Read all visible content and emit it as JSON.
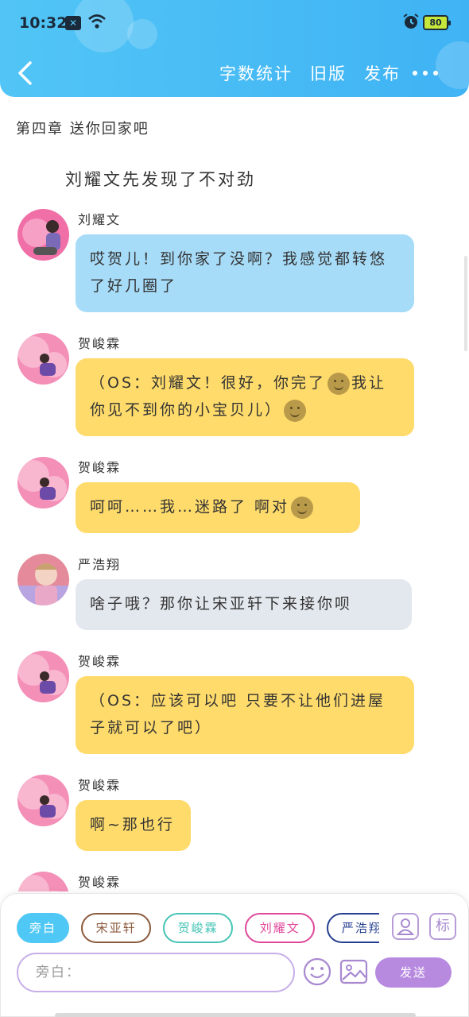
{
  "status_bar": {
    "time": "10:32",
    "battery": "80"
  },
  "header": {
    "actions": [
      "字数统计",
      "旧版",
      "发布"
    ]
  },
  "chapter": {
    "title": "第四章 送你回家吧",
    "narration": "刘耀文先发现了不对劲"
  },
  "messages": [
    {
      "speaker": "刘耀文",
      "style": "blue",
      "text": "哎贺儿！到你家了没啊？我感觉都转悠了好几圈了",
      "avatar_color": "#ef6fa6"
    },
    {
      "speaker": "贺峻霖",
      "style": "yellow",
      "parts": [
        "（OS：刘耀文！很好，你完了",
        "我让你见不到你的小宝贝儿）"
      ],
      "avatar_color": "#f48fb7"
    },
    {
      "speaker": "贺峻霖",
      "style": "yellow",
      "parts": [
        "呵呵……我…迷路了 啊对"
      ],
      "avatar_color": "#f48fb7"
    },
    {
      "speaker": "严浩翔",
      "style": "gray",
      "text": "啥子哦？那你让宋亚轩下来接你呗",
      "avatar_color": "#e48a9a"
    },
    {
      "speaker": "贺峻霖",
      "style": "yellow",
      "text": "（OS：应该可以吧 只要不让他们进屋子就可以了吧）",
      "avatar_color": "#f48fb7"
    },
    {
      "speaker": "贺峻霖",
      "style": "yellow",
      "text": "啊~那也行",
      "avatar_color": "#f48fb7"
    },
    {
      "speaker": "贺峻霖",
      "style": "yellow",
      "text": "",
      "avatar_color": "#f48fb7"
    }
  ],
  "bottom": {
    "roles": [
      "旁白",
      "宋亚轩",
      "贺峻霖",
      "刘耀文",
      "严浩翔"
    ],
    "role_icon_char": "标",
    "input_placeholder": "旁白：",
    "send_label": "发送"
  }
}
